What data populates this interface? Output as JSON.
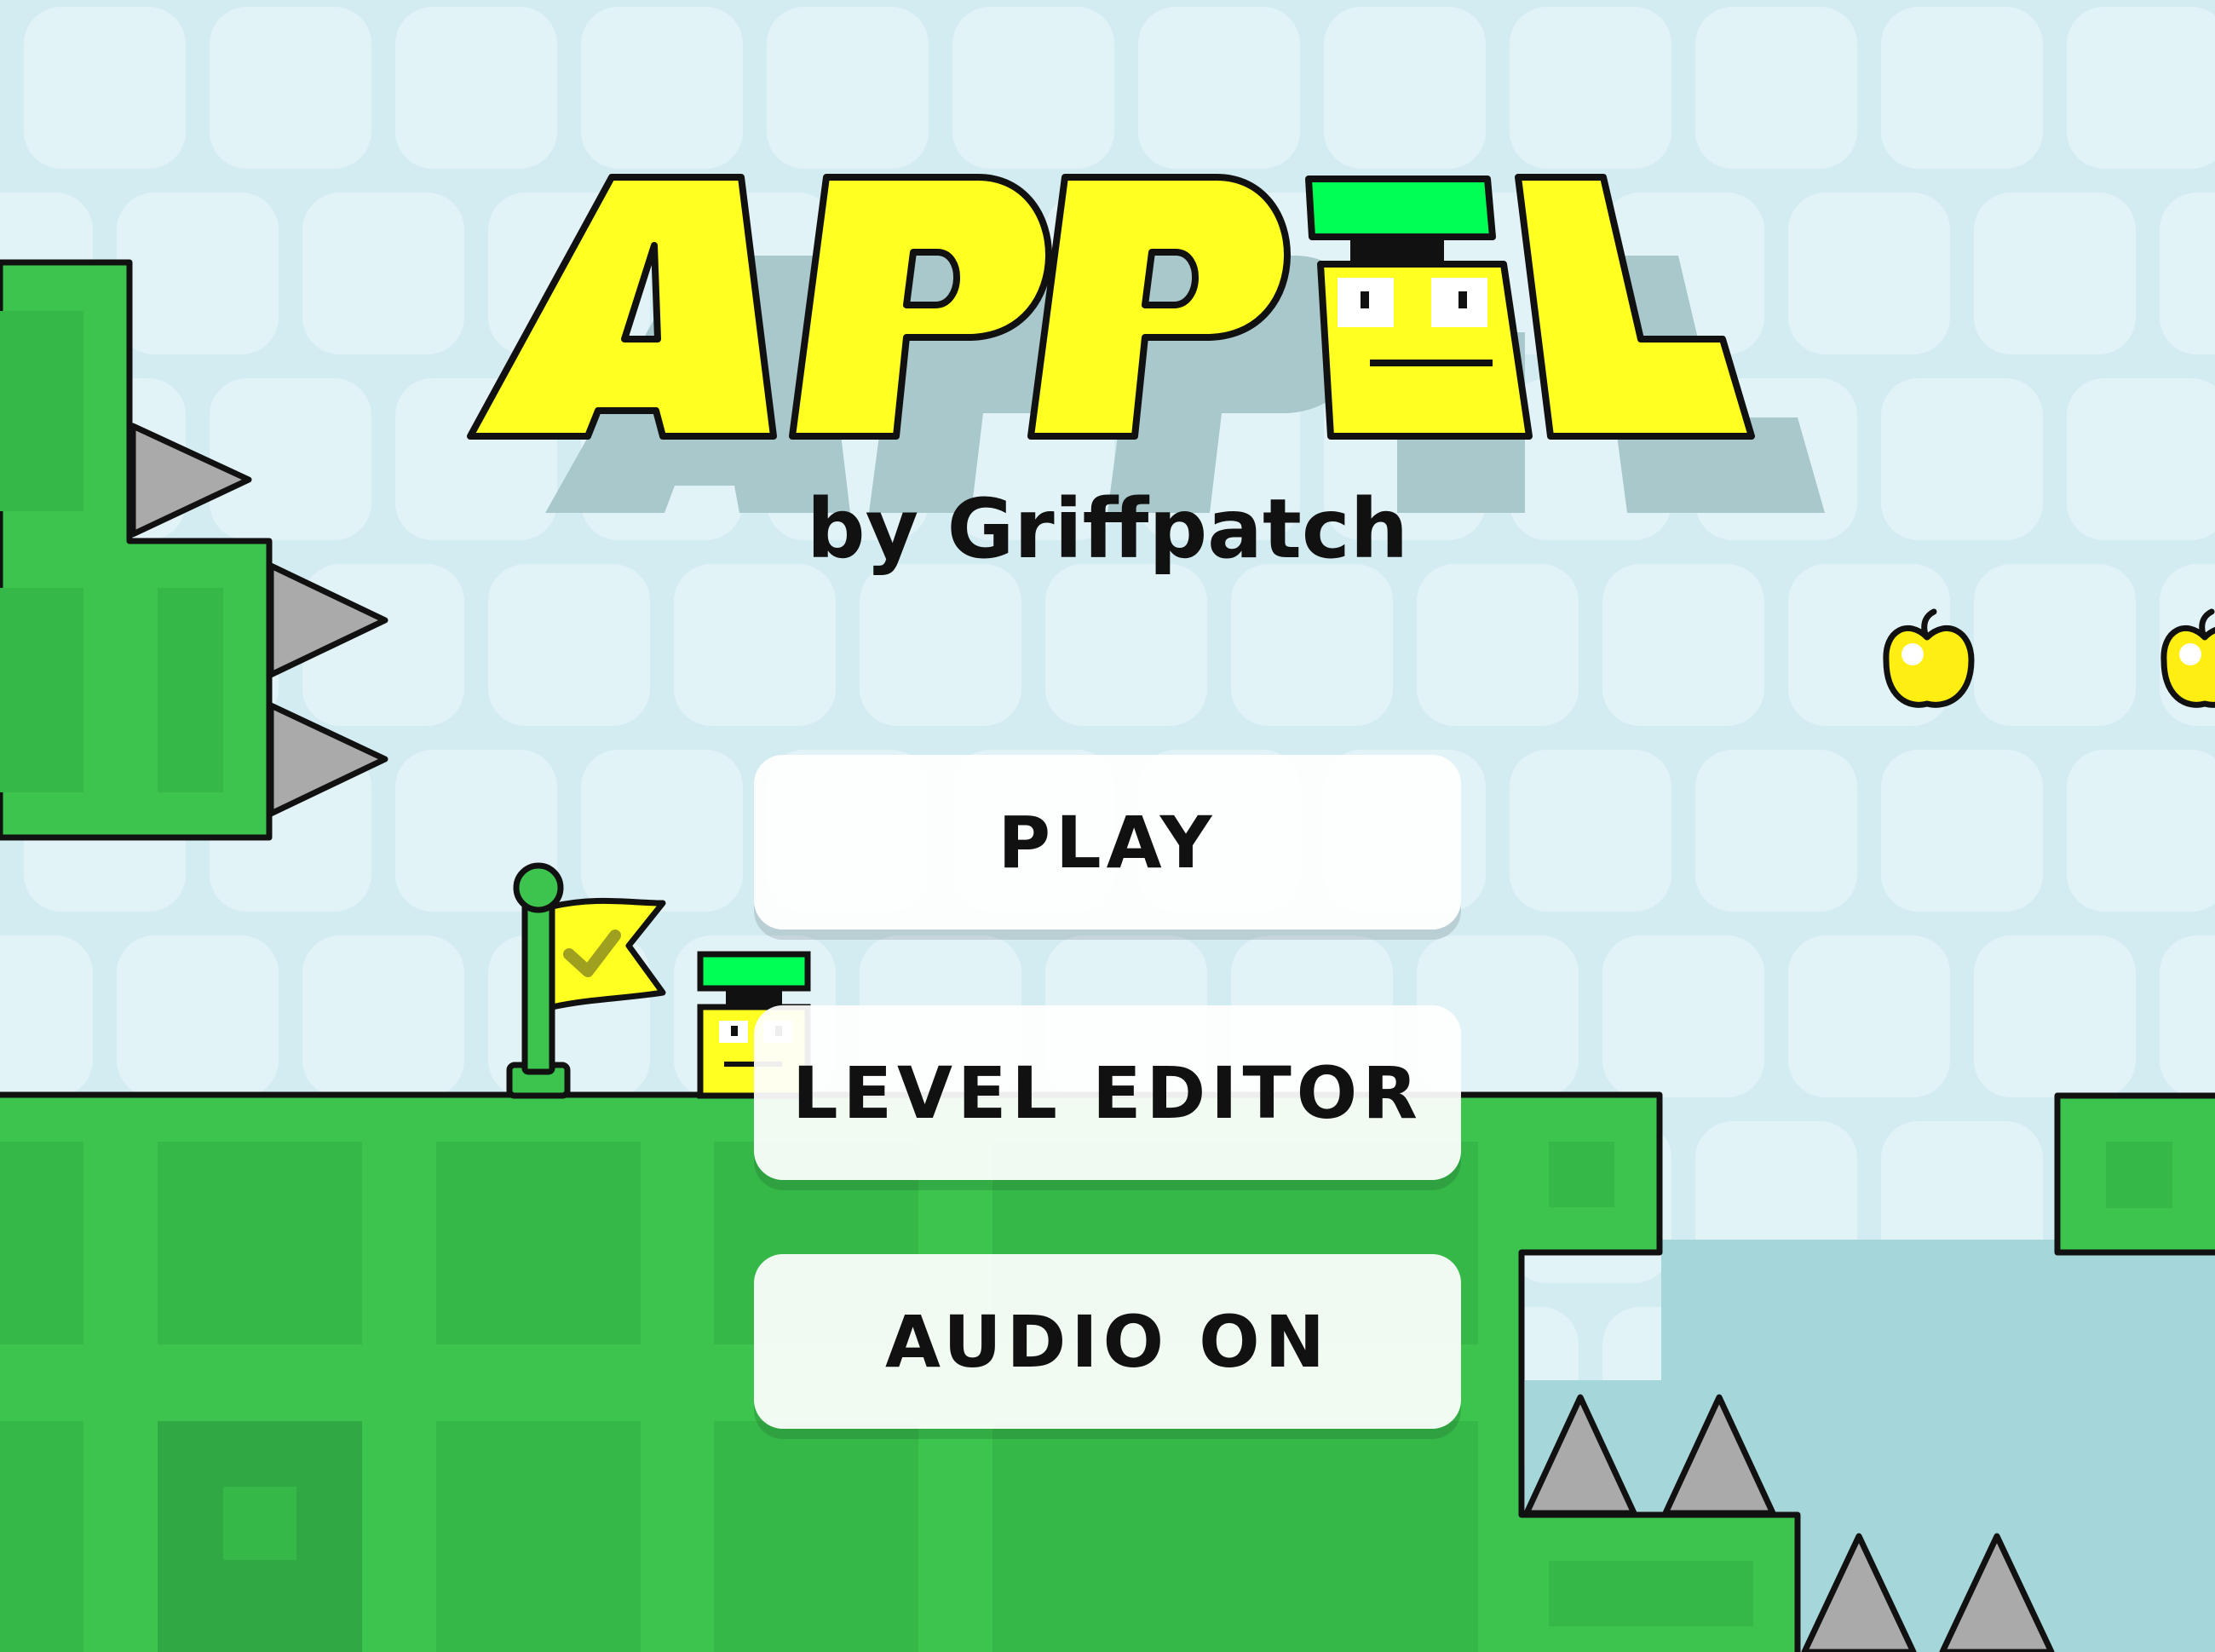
{
  "game": {
    "title": "APPEL",
    "subtitle": "by Griffpatch"
  },
  "menu": {
    "play_label": "PLAY",
    "level_editor_label": "LEVEL EDITOR",
    "audio_label": "AUDIO ON"
  },
  "icons": {
    "goal": "checkpoint-flag-icon",
    "player": "appel-character-icon",
    "collectible": "apple-icon",
    "hazard": "spike-icon"
  },
  "colors": {
    "sky": "#D3ECF2",
    "sky_tile": "#E2F3F8",
    "ground": "#3CC44F",
    "ground_tile": "#36B849",
    "water": "#A5D6DA",
    "title_yellow": "#FFFF22",
    "title_shadow": "#A8C8CC",
    "accent_green": "#00FF55",
    "spike": "#AAAAAA",
    "outline": "#111111"
  }
}
